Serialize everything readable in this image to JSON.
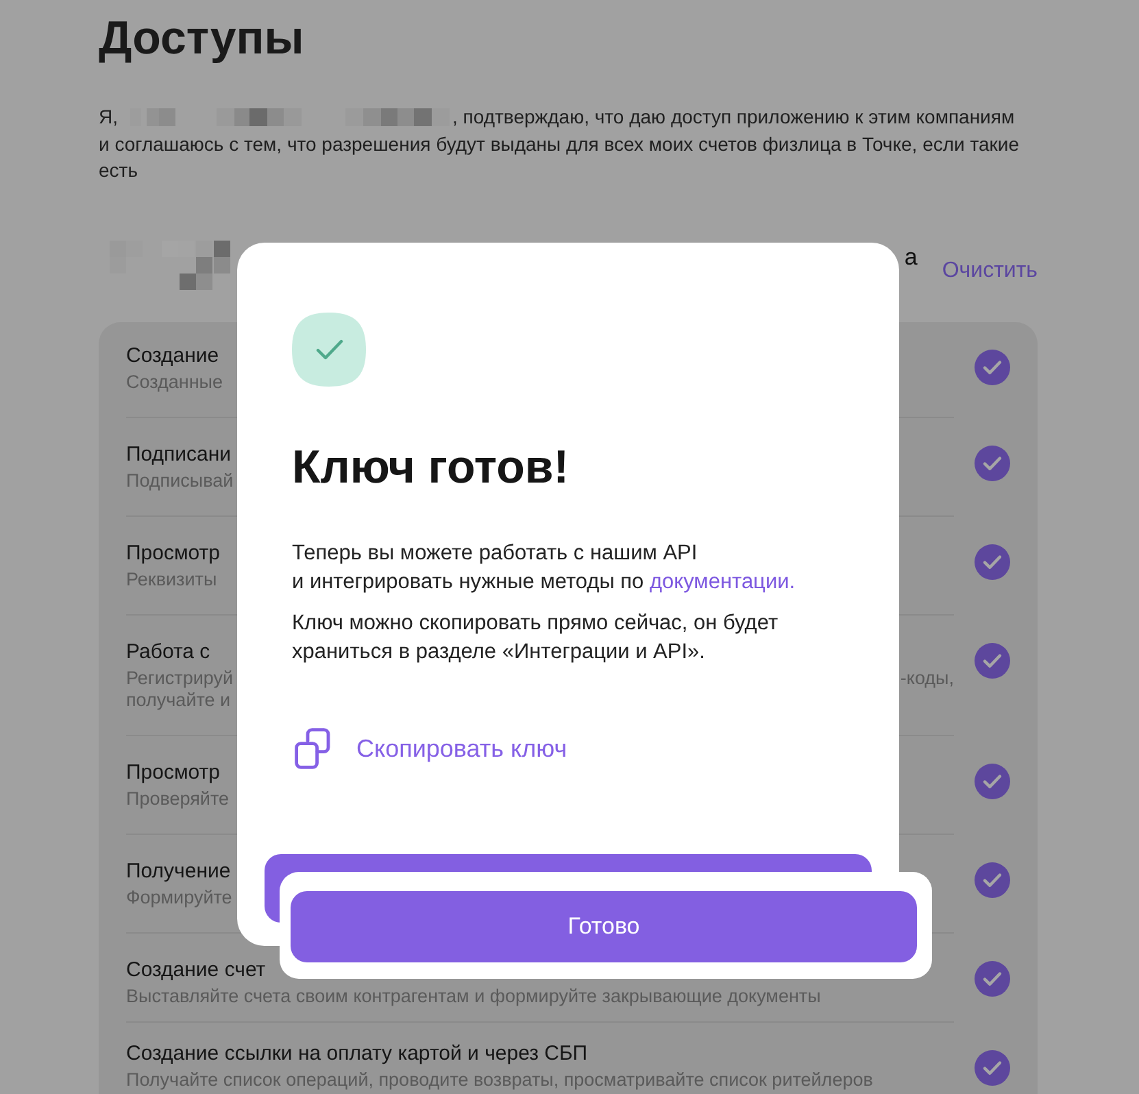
{
  "page": {
    "title": "Доступы",
    "consent": {
      "before": "Я,",
      "after": ", подтверждаю, что даю доступ приложению к этим компаниям\nи соглашаюсь с тем, что разрешения будут выданы для всех моих счетов физлица в Точке, если такие\nесть"
    }
  },
  "company": {
    "name_tail": "а",
    "clear_link": "Очистить"
  },
  "permissions": [
    {
      "title": "Создание",
      "description": "Созданные",
      "checked": true
    },
    {
      "title": "Подписани",
      "description": "Подписывай",
      "checked": true
    },
    {
      "title": "Просмотр",
      "description": "Реквизиты",
      "checked": true
    },
    {
      "title": "Работа с",
      "description": "Регистрируй\nполучайте и",
      "description_tail": "-коды,",
      "checked": true
    },
    {
      "title": "Просмотр",
      "description": "Проверяйте",
      "checked": true
    },
    {
      "title": "Получение",
      "description": "Формируйте",
      "checked": true
    },
    {
      "title": "Создание счет",
      "description": "Выставляйте счета своим контрагентам и формируйте закрывающие документы",
      "checked": true
    },
    {
      "title": "Создание ссылки на оплату картой и через СБП",
      "description": "Получайте список операций, проводите возвраты, просматривайте список ритейлеров",
      "checked": true
    }
  ],
  "dialog": {
    "title": "Ключ готов!",
    "text_1": "Теперь вы можете работать с нашим API\nи интегрировать нужные методы по ",
    "link": "документации.",
    "text_2": "Ключ можно скопировать прямо сейчас, он будет\nхраниться в разделе «Интеграции и API».",
    "copy_action": "Скопировать ключ"
  },
  "highlight": {
    "button": "Готово"
  }
}
